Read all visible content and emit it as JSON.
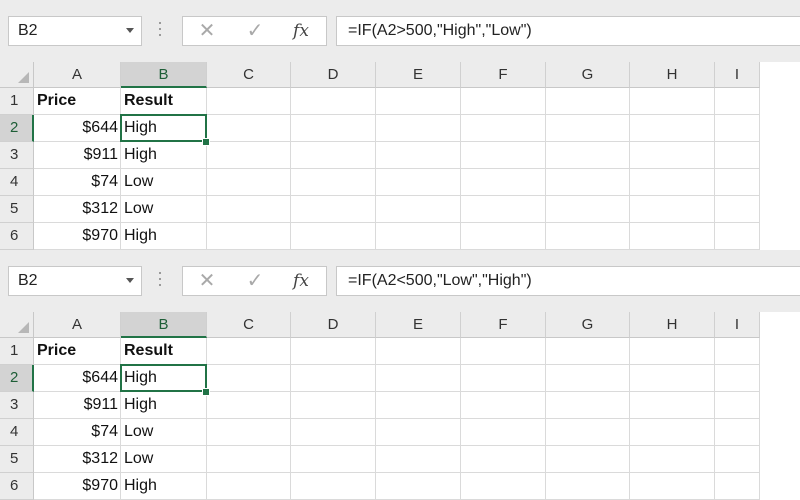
{
  "panels": [
    {
      "name_box": "B2",
      "formula": "=IF(A2>500,\"High\",\"Low\")",
      "fx_label": "fx",
      "columns": [
        "A",
        "B",
        "C",
        "D",
        "E",
        "F",
        "G",
        "H",
        "I"
      ],
      "row_numbers": [
        "1",
        "2",
        "3",
        "4",
        "5",
        "6"
      ],
      "header_row": [
        "Price",
        "Result"
      ],
      "data_rows": [
        {
          "price": "$644",
          "result": "High"
        },
        {
          "price": "$911",
          "result": "High"
        },
        {
          "price": "$74",
          "result": "Low"
        },
        {
          "price": "$312",
          "result": "Low"
        },
        {
          "price": "$970",
          "result": "High"
        }
      ],
      "selected_cell": "B2"
    },
    {
      "name_box": "B2",
      "formula": "=IF(A2<500,\"Low\",\"High\")",
      "fx_label": "fx",
      "columns": [
        "A",
        "B",
        "C",
        "D",
        "E",
        "F",
        "G",
        "H",
        "I"
      ],
      "row_numbers": [
        "1",
        "2",
        "3",
        "4",
        "5",
        "6"
      ],
      "header_row": [
        "Price",
        "Result"
      ],
      "data_rows": [
        {
          "price": "$644",
          "result": "High"
        },
        {
          "price": "$911",
          "result": "High"
        },
        {
          "price": "$74",
          "result": "Low"
        },
        {
          "price": "$312",
          "result": "Low"
        },
        {
          "price": "$970",
          "result": "High"
        }
      ],
      "selected_cell": "B2"
    }
  ],
  "icons": {
    "cancel": "close-icon",
    "enter": "checkmark-icon",
    "function": "fx-icon",
    "dropdown": "chevron-down-icon"
  },
  "colors": {
    "accent": "#217346",
    "header_bg": "#ececec",
    "selected_header_bg": "#d3d3d3",
    "gridline": "#dadada"
  }
}
